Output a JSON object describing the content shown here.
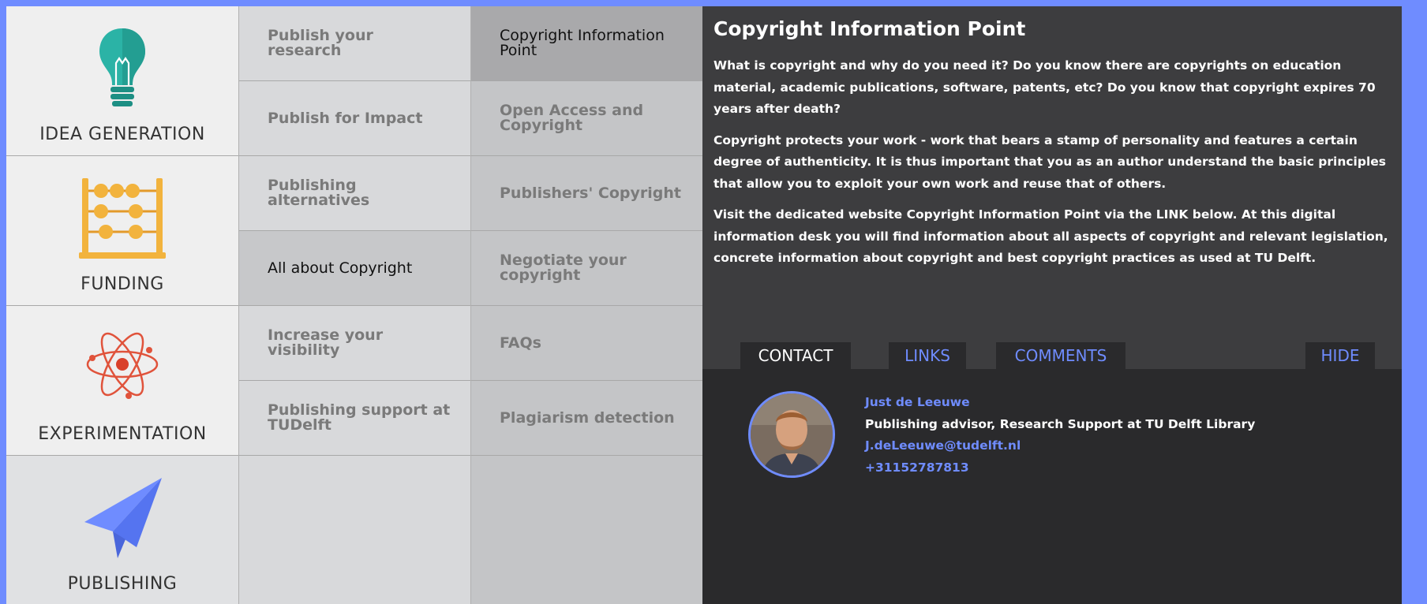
{
  "categories": [
    {
      "label": "IDEA GENERATION",
      "icon": "lightbulb-icon"
    },
    {
      "label": "FUNDING",
      "icon": "abacus-icon"
    },
    {
      "label": "EXPERIMENTATION",
      "icon": "atom-icon"
    },
    {
      "label": "PUBLISHING",
      "icon": "paper-plane-icon",
      "active": true
    }
  ],
  "column2": {
    "items": [
      "Publish your research",
      "Publish for Impact",
      "Publishing alternatives",
      "All about Copyright",
      "Increase your visibility",
      "Publishing support at TUDelft"
    ],
    "active_index": 3
  },
  "column3": {
    "items": [
      "Copyright Information Point",
      "Open Access and Copyright",
      "Publishers' Copyright",
      "Negotiate your copyright",
      "FAQs",
      "Plagiarism detection"
    ],
    "active_index": 0
  },
  "content": {
    "title": "Copyright Information Point",
    "paragraphs": [
      "What is copyright and why do you need it? Do you know there are copyrights on education material, academic publications, software, patents, etc? Do you know that copyright expires 70 years after death?",
      "Copyright protects your work - work that bears a stamp of personality and features a certain degree of authenticity. It is thus important that you as an author understand the basic principles that allow you to exploit your own work and reuse that of others.",
      "Visit the dedicated website Copyright Information Point via the LINK below. At this digital information desk you will find information about all aspects of copyright and relevant legislation, concrete information about copyright and best copyright practices as used at TU Delft."
    ]
  },
  "tabs": {
    "contact": "CONTACT",
    "links": "LINKS",
    "comments": "COMMENTS",
    "hide": "HIDE",
    "active": "contact"
  },
  "contact": {
    "name": "Just de Leeuwe",
    "role": "Publishing advisor, Research Support at TU Delft Library",
    "email": "J.deLeeuwe@tudelft.nl",
    "phone": "+31152787813"
  },
  "colors": {
    "accent": "#6f8cff",
    "panel_dark": "#2a2a2c",
    "panel_mid": "#3d3d3f",
    "teal": "#2bb3a6",
    "orange": "#f2b33d",
    "red_orange": "#e0533b"
  }
}
